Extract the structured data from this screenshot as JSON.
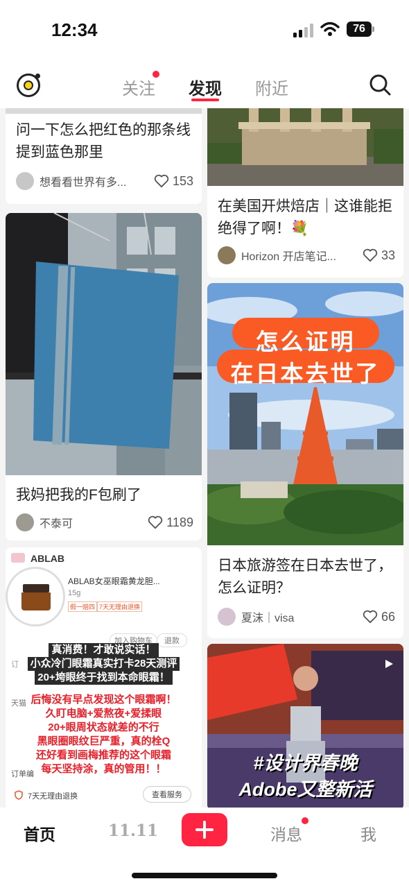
{
  "status_bar": {
    "time": "12:34",
    "battery": "76"
  },
  "top_nav": {
    "tabs": [
      {
        "label": "关注",
        "has_dot": true
      },
      {
        "label": "发现",
        "active": true
      },
      {
        "label": "附近"
      }
    ]
  },
  "feed": {
    "cards": [
      {
        "title": "问一下怎么把红色的那条线提到蓝色那里",
        "author": "想看看世界有多...",
        "likes": "153"
      },
      {
        "title": "在美国开烘焙店｜这谁能拒绝得了啊！💐",
        "author": "Horizon 开店笔记...",
        "likes": "33"
      },
      {
        "title": "我妈把我的F包刷了",
        "author": "不泰可",
        "likes": "1189"
      },
      {
        "title": "日本旅游签在日本去世了，怎么证明？",
        "author": "夏沫｜visa",
        "likes": "66",
        "image_text": [
          "怎么证明",
          "在日本去世了"
        ]
      },
      {
        "image_text": {
          "brand": "ABLAB",
          "product": "ABLAB女巫眼霜黄龙胆...",
          "spec": "15g",
          "tags": [
            "假一赔四",
            "7天无理由退换"
          ],
          "cart": "加入购物车",
          "refund": "退款",
          "side_labels": [
            "订",
            "天猫",
            "订单编"
          ],
          "lines_black": [
            "真消费！才敢说实话！",
            "小众冷门眼霜真实打卡28天测评",
            "20+垮眼终于找到本命眼霜！"
          ],
          "lines_red": [
            "后悔没有早点发现这个眼霜啊！",
            "久盯电脑+爱熬夜+爱揉眼",
            "20+眼周状态就差的不行",
            "黑眼圈眼纹巨严重，真的栓Q",
            "还好看到画梅推荐的这个眼霜",
            "每天坚持涂，真的管用！！"
          ],
          "footer_left": "7天无理由退换",
          "footer_btn": "查看服务"
        }
      },
      {
        "image_text": [
          "#设计界春晚",
          "Adobe又整新活"
        ]
      }
    ]
  },
  "bottom_nav": {
    "items": [
      {
        "label": "首页",
        "active": true
      },
      {
        "label": "11.11"
      },
      {
        "label": "消息",
        "has_dot": true
      },
      {
        "label": "我"
      }
    ]
  },
  "colors": {
    "accent": "#ff2442",
    "background": "#f4f4f4"
  }
}
